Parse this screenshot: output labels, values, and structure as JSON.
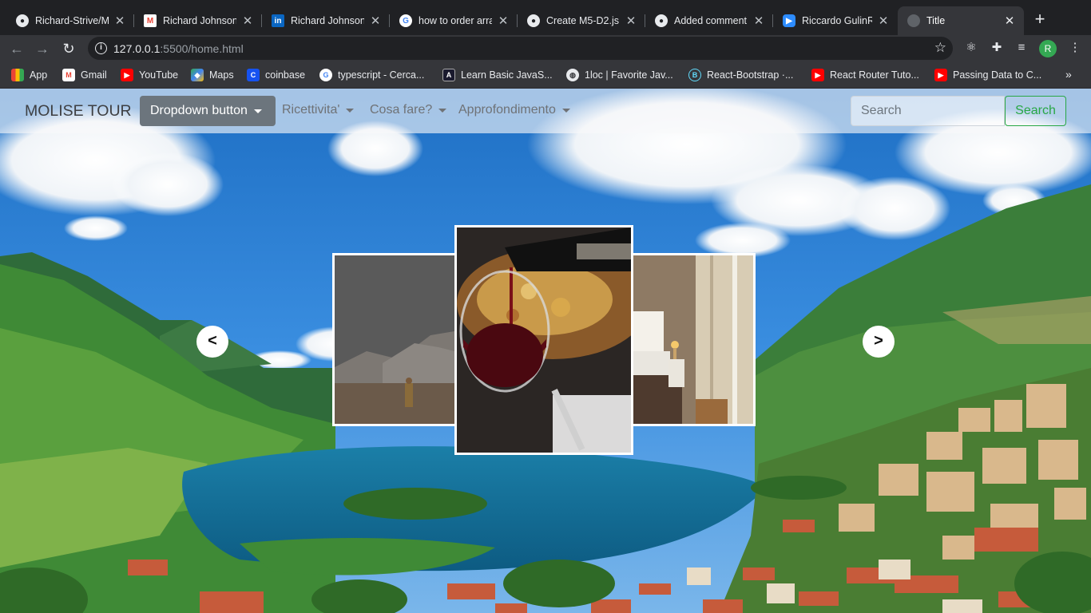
{
  "browser": {
    "tabs": [
      {
        "title": "Richard-Strive/M",
        "icon": "github-icon",
        "active": false
      },
      {
        "title": "Richard Johnson",
        "icon": "gmail-icon",
        "active": false
      },
      {
        "title": "Richard Johnson",
        "icon": "linkedin-icon",
        "active": false
      },
      {
        "title": "how to order arra",
        "icon": "google-icon",
        "active": false
      },
      {
        "title": "Create M5-D2.js",
        "icon": "github-icon",
        "active": false
      },
      {
        "title": "Added comment",
        "icon": "github-icon",
        "active": false
      },
      {
        "title": "Riccardo GulinRi",
        "icon": "zoom-icon",
        "active": false
      },
      {
        "title": "Title",
        "icon": "globe-icon",
        "active": true
      }
    ],
    "address": {
      "host": "127.0.0.1",
      "path": ":5500/home.html"
    },
    "profile_initial": "R",
    "bookmarks": [
      {
        "label": "App",
        "icon": "apps-grid-icon"
      },
      {
        "label": "Gmail",
        "icon": "gmail-icon"
      },
      {
        "label": "YouTube",
        "icon": "youtube-icon"
      },
      {
        "label": "Maps",
        "icon": "maps-icon"
      },
      {
        "label": "coinbase",
        "icon": "coinbase-icon"
      },
      {
        "label": "typescript - Cerca...",
        "icon": "google-icon"
      },
      {
        "label": "Learn Basic JavaS...",
        "icon": "course-icon"
      },
      {
        "label": "1loc | Favorite Jav...",
        "icon": "globe-icon"
      },
      {
        "label": "React-Bootstrap ·...",
        "icon": "react-bootstrap-icon"
      },
      {
        "label": "React Router Tuto...",
        "icon": "youtube-icon"
      },
      {
        "label": "Passing Data to C...",
        "icon": "youtube-icon"
      }
    ],
    "more_bookmarks": "»"
  },
  "site": {
    "brand": "MOLISE TOUR",
    "dropdown_button": "Dropdown button",
    "nav_links": [
      "Ricettivita'",
      "Cosa fare?",
      "Approfondimento"
    ],
    "search_placeholder": "Search",
    "search_button": "Search",
    "carousel": {
      "prev_label": "<",
      "next_label": ">",
      "slides": [
        "mountain-hiker-photo",
        "red-wine-pour-photo",
        "hotel-bedroom-photo"
      ]
    }
  },
  "colors": {
    "chrome_dark": "#202124",
    "chrome_toolbar": "#35363a",
    "success_green": "#28a745",
    "secondary_gray": "#6c757d"
  }
}
